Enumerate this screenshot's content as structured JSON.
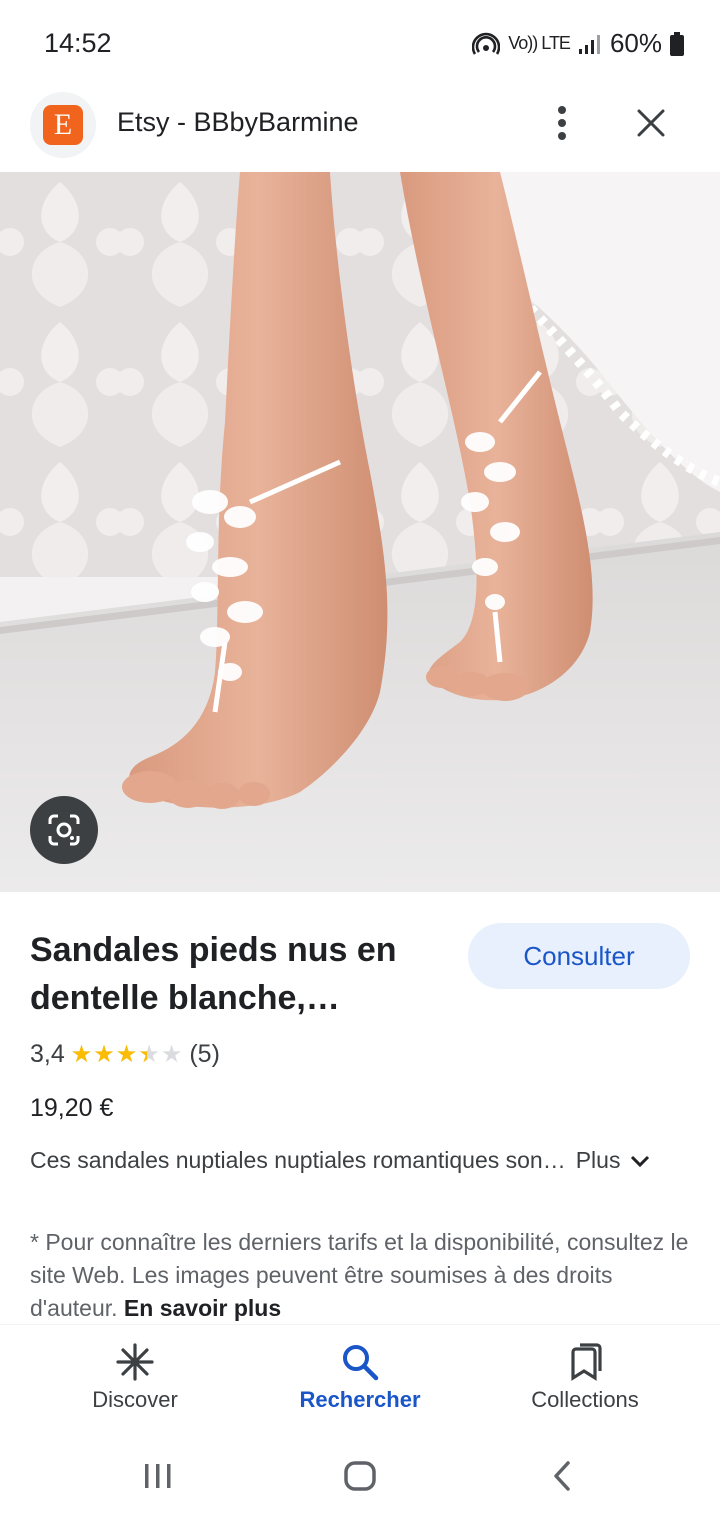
{
  "status_bar": {
    "time": "14:52",
    "network": "LTE",
    "volte": "Vo)) LTE",
    "battery": "60%",
    "icons": [
      "hotspot-icon",
      "signal-icon",
      "battery-icon"
    ]
  },
  "header": {
    "site_logo_letter": "E",
    "title": "Etsy - BBbyBarmine",
    "icons": [
      "more-vert-icon",
      "close-icon"
    ],
    "brand_color": "#f1641e"
  },
  "image": {
    "lens_icon": "google-lens-icon"
  },
  "product": {
    "title_line1": "Sandales pieds nus en",
    "title_line2": "dentelle blanche,…",
    "visit_label": "Consulter",
    "rating": "3,4",
    "rating_value": 3.4,
    "rating_max": 5,
    "review_count": "(5)",
    "price": "19,20 €",
    "description": "Ces sandales nuptiales nuptiales romantiques son…",
    "more_label": "Plus",
    "star_color": "#fbbc04"
  },
  "disclaimer": {
    "text": "* Pour connaître les derniers tarifs et la disponibilité, consultez le site Web. Les images peuvent être soumises à des droits d'auteur.",
    "learn_more": "En savoir plus"
  },
  "bottom_nav": {
    "items": [
      {
        "label": "Discover",
        "icon": "asterisk-icon",
        "active": false
      },
      {
        "label": "Rechercher",
        "icon": "search-icon",
        "active": true
      },
      {
        "label": "Collections",
        "icon": "bookmarks-icon",
        "active": false
      }
    ],
    "accent": "#1a56c8"
  },
  "system_nav": {
    "icons": [
      "recents-icon",
      "home-icon",
      "back-icon"
    ]
  }
}
